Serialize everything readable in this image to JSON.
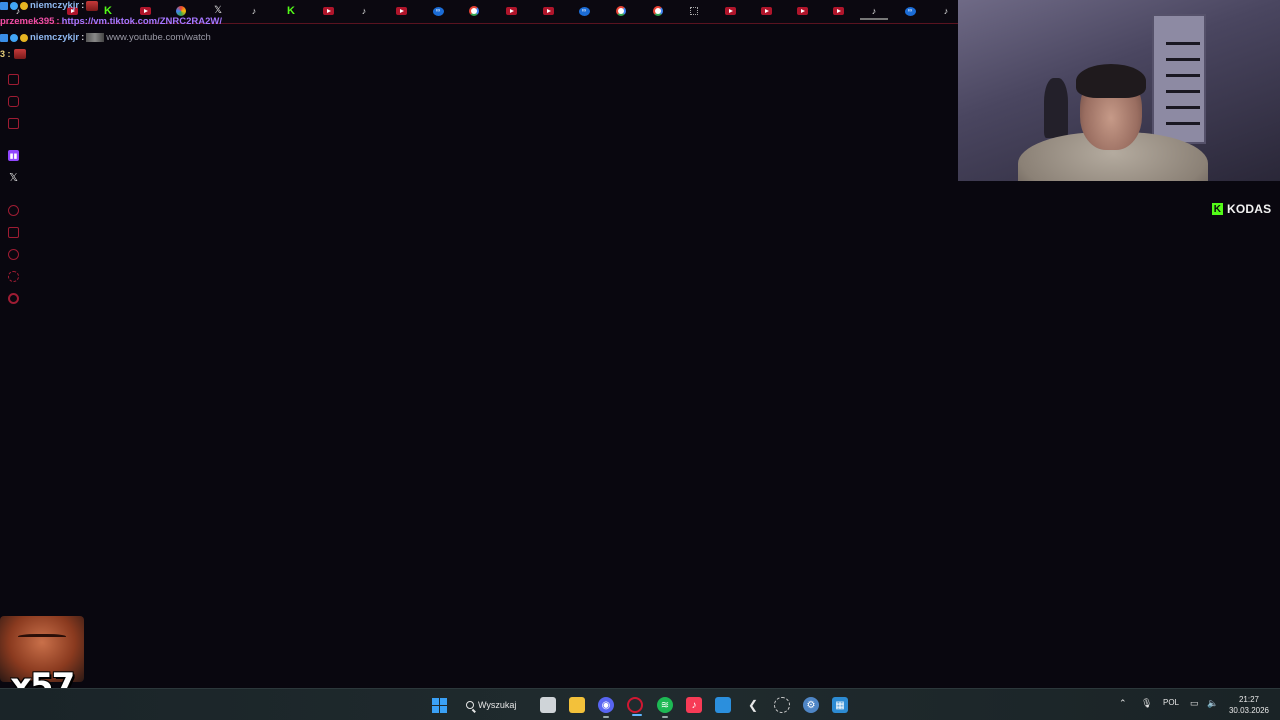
{
  "chat": {
    "line1_user": "niemczykjr",
    "line1_sep": ":",
    "line2_user": "przemek395",
    "line2_sep": ":",
    "line2_message": "https://vm.tiktok.com/ZNRC2RA2W/",
    "line3_user": "niemczykjr",
    "line3_sep": ":",
    "line3_message": "www.youtube.com/watch",
    "line4_prefix": "3 :"
  },
  "tabs": [
    "tiktok",
    "youtube",
    "kick",
    "youtube",
    "chrome-color",
    "x",
    "tiktok",
    "kick",
    "youtube",
    "tiktok",
    "youtube",
    "meta",
    "google",
    "youtube",
    "youtube",
    "meta",
    "google",
    "google",
    "grid",
    "youtube",
    "youtube",
    "youtube",
    "youtube",
    "tiktok",
    "meta",
    "tiktok"
  ],
  "side_rail_icons": [
    "lock-icon",
    "instagram-icon",
    "mail-icon",
    "twitch-icon",
    "x-icon",
    "record-icon",
    "pin-icon",
    "clock-icon",
    "refresh-icon",
    "settings-icon"
  ],
  "stream_overlay": {
    "brand": "KODAS",
    "brand_mark": "K",
    "emote_count": "x57"
  },
  "taskbar": {
    "search_label": "Wyszukaj",
    "language": "POL",
    "time": "21:27",
    "date": "30.03.2026"
  },
  "colors": {
    "accent_red": "#9e1c33",
    "kick_green": "#53fc18",
    "twitch_purple": "#9146ff",
    "background": "#09070f"
  }
}
